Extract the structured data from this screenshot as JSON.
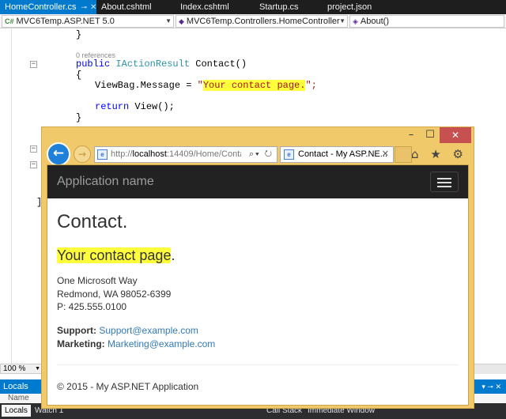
{
  "vs": {
    "doc_tabs": [
      {
        "label": "HomeController.cs",
        "active": true
      },
      {
        "label": "About.cshtml"
      },
      {
        "label": "Index.cshtml"
      },
      {
        "label": "Startup.cs"
      },
      {
        "label": "project.json"
      }
    ],
    "nav": {
      "project": "MVC6Temp.ASP.NET 5.0",
      "class": "MVC6Temp.Controllers.HomeController",
      "member": "About()"
    },
    "code": {
      "close_brace": "}",
      "references": "0 references",
      "kw_public": "public",
      "return_type": "IActionResult",
      "method_rest": " Contact()",
      "open_brace": "{",
      "assign_prefix": "ViewBag.Message = ",
      "quote": "\"",
      "message": "Your contact page.",
      "assign_suffix": "\";",
      "kw_return": "return",
      "return_rest": " View();",
      "bracket": "]"
    },
    "zoom": "100 %",
    "locals_title": "Locals",
    "locals_column": "Name",
    "bottom_tabs": [
      "Locals",
      "Watch 1",
      "Call Stack",
      "Immediate Window"
    ]
  },
  "browser": {
    "back_glyph": "←",
    "forward_glyph": "→",
    "address_prefix": "http://",
    "address_host": "localhost",
    "address_rest": ":14409/Home/Conta",
    "address_tools": "⌕▾ ↻",
    "tab_label": "Contact - My ASP.NE...",
    "toolbar_icons": "⌂ ★ ⚙",
    "window_buttons": {
      "minimize": "–",
      "maximize": "☐",
      "close": "✕"
    }
  },
  "site": {
    "brand": "Application name",
    "heading": "Contact.",
    "message": "Your contact page",
    "message_end": ".",
    "address_lines": [
      "One Microsoft Way",
      "Redmond, WA 98052-6399",
      "P: 425.555.0100"
    ],
    "support_label": "Support:",
    "support_email": "Support@example.com",
    "marketing_label": "Marketing:",
    "marketing_email": "Marketing@example.com",
    "footer": "© 2015 - My ASP.NET Application"
  }
}
